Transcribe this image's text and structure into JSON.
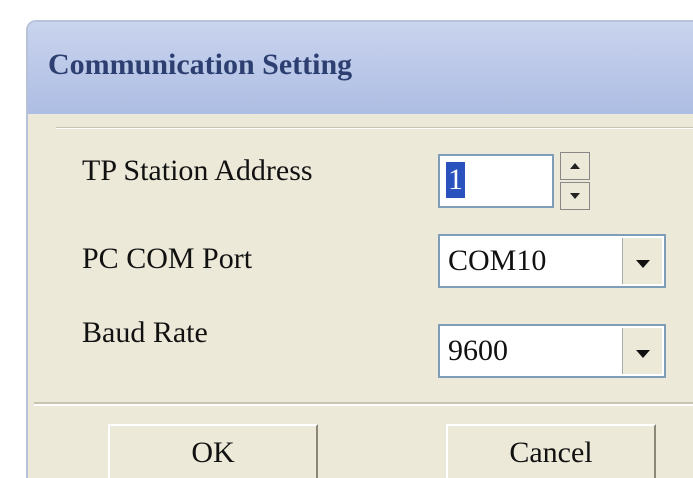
{
  "window": {
    "title": "Communication Setting"
  },
  "form": {
    "station_address": {
      "label": "TP Station Address",
      "value": "1"
    },
    "com_port": {
      "label": "PC COM Port",
      "selected": "COM10"
    },
    "baud_rate": {
      "label": "Baud Rate",
      "selected": "9600"
    }
  },
  "buttons": {
    "ok": "OK",
    "cancel": "Cancel"
  },
  "icons": {
    "spin_up": "up-arrow-icon",
    "spin_down": "down-arrow-icon",
    "dropdown": "chevron-down-icon"
  },
  "colors": {
    "dialog_bg": "#ece9d8",
    "title_text": "#2c3f70",
    "field_border": "#7f9db9",
    "selection": "#2a52be"
  }
}
